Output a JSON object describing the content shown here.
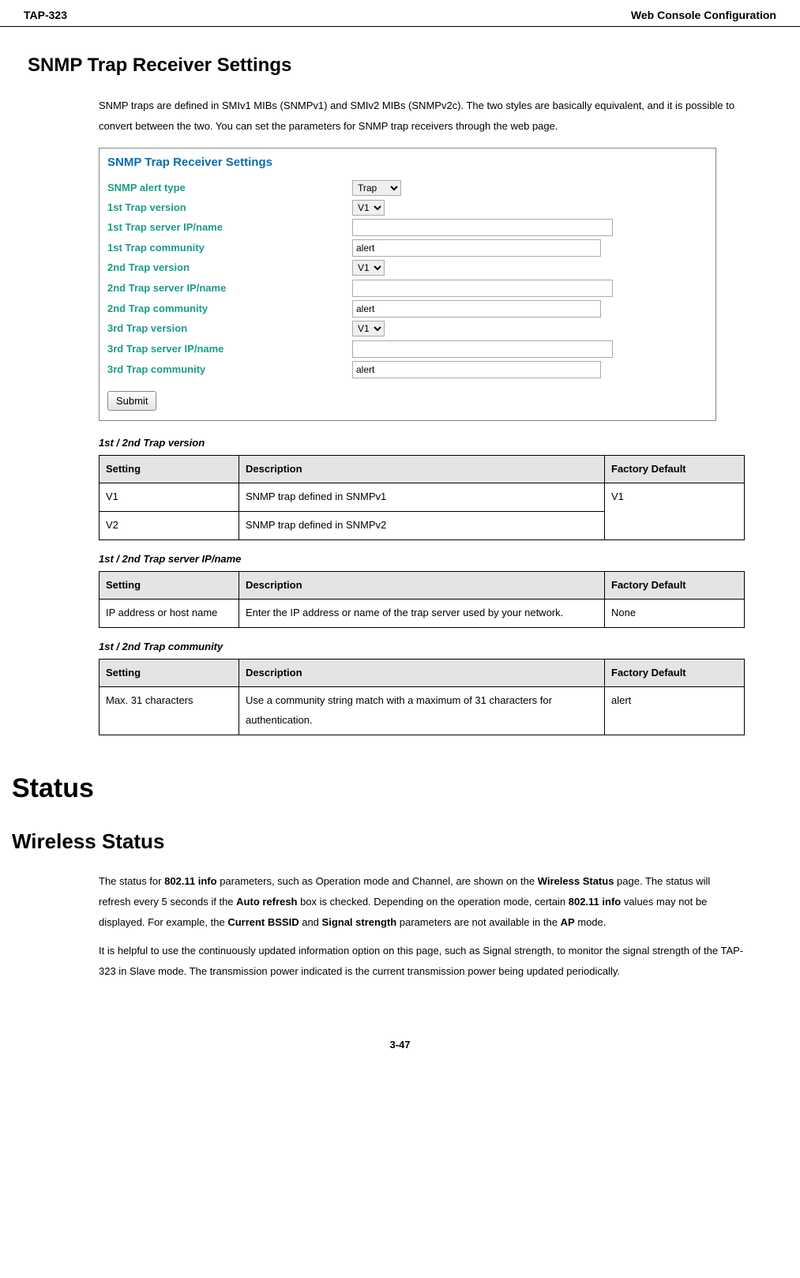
{
  "header": {
    "left": "TAP-323",
    "right": "Web Console Configuration"
  },
  "section1": {
    "title": "SNMP Trap Receiver Settings",
    "intro": "SNMP traps are defined in SMIv1 MIBs (SNMPv1) and SMIv2 MIBs (SNMPv2c). The two styles are basically equivalent, and it is possible to convert between the two. You can set the parameters for SNMP trap receivers through the web page."
  },
  "shot": {
    "title": "SNMP Trap Receiver Settings",
    "rows": {
      "alert_type": {
        "label": "SNMP alert type",
        "value": "Trap"
      },
      "v1_version": {
        "label": "1st Trap version",
        "value": "V1"
      },
      "v1_server": {
        "label": "1st Trap server IP/name",
        "value": ""
      },
      "v1_community": {
        "label": "1st Trap community",
        "value": "alert"
      },
      "v2_version": {
        "label": "2nd Trap version",
        "value": "V1"
      },
      "v2_server": {
        "label": "2nd Trap server IP/name",
        "value": ""
      },
      "v2_community": {
        "label": "2nd Trap community",
        "value": "alert"
      },
      "v3_version": {
        "label": "3rd Trap version",
        "value": "V1"
      },
      "v3_server": {
        "label": "3rd Trap server IP/name",
        "value": ""
      },
      "v3_community": {
        "label": "3rd Trap community",
        "value": "alert"
      }
    },
    "submit": "Submit"
  },
  "tables": {
    "headers": {
      "setting": "Setting",
      "description": "Description",
      "default": "Factory Default"
    },
    "t1": {
      "caption": "1st / 2nd Trap version",
      "rows": [
        {
          "setting": "V1",
          "desc": "SNMP trap defined in SNMPv1"
        },
        {
          "setting": "V2",
          "desc": "SNMP trap defined in SNMPv2"
        }
      ],
      "default": "V1"
    },
    "t2": {
      "caption": "1st / 2nd Trap server IP/name",
      "rows": [
        {
          "setting": "IP address or host name",
          "desc": "Enter the IP address or name of the trap server used by your network."
        }
      ],
      "default": "None"
    },
    "t3": {
      "caption": "1st / 2nd Trap community",
      "rows": [
        {
          "setting": "Max. 31 characters",
          "desc": "Use a community string match with a maximum of 31 characters for authentication."
        }
      ],
      "default": "alert"
    }
  },
  "status": {
    "h1": "Status",
    "h2": "Wireless Status",
    "p1": {
      "a": "The status for ",
      "b1": "802.11 info",
      "c": " parameters, such as Operation mode and Channel, are shown on the ",
      "b2": "Wireless Status",
      "d": " page. The status will refresh every 5 seconds if the ",
      "b3": "Auto refresh",
      "e": " box is checked. Depending on the operation mode, certain ",
      "b4": "802.11 info",
      "f": " values may not be displayed. For example, the ",
      "b5": "Current BSSID",
      "g": " and ",
      "b6": "Signal strength",
      "h": " parameters are not available in the ",
      "b7": "AP",
      "i": " mode."
    },
    "p2": "It is helpful to use the continuously updated information option on this page, such as Signal strength, to monitor the signal strength of the TAP-323 in Slave mode. The transmission power indicated is the current transmission power being updated periodically."
  },
  "footer": "3-47"
}
